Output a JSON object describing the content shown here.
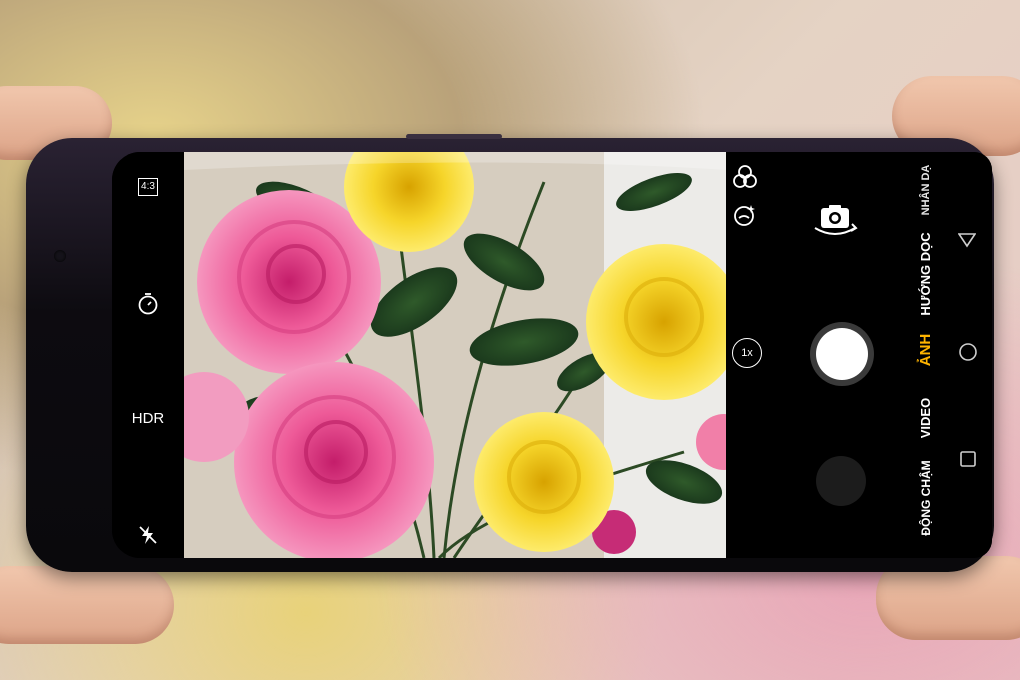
{
  "camera": {
    "left_bar": {
      "aspect_ratio": "4:3",
      "timer_icon": "timer-icon",
      "hdr": "HDR",
      "flash_icon": "flash-off-icon"
    },
    "controls": {
      "filter_icon": "filter-icon",
      "beauty_icon": "beauty-icon",
      "switch_camera_icon": "switch-camera-icon",
      "zoom": "1x",
      "modes": [
        "NHÂN DẠ",
        "HƯỚNG DỌC",
        "ẢNH",
        "VIDEO",
        "ĐỘNG CHẬM"
      ],
      "active_mode": "ẢNH"
    },
    "colors": {
      "active_mode": "#ffb400",
      "shutter": "#ffffff",
      "background": "#000000"
    }
  }
}
